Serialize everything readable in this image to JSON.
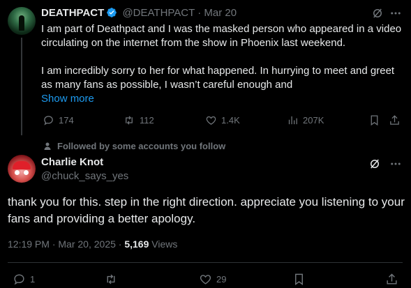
{
  "parent_tweet": {
    "display_name": "DEATHPACT",
    "handle": "@DEATHPACT",
    "separator": "·",
    "date": "Mar 20",
    "text_p1": "I am part of Deathpact and I was the masked person who appeared in a video circulating on the internet from the show in Phoenix last weekend.",
    "text_p2": "I am incredibly sorry to her for what happened. In hurrying to meet and greet as many fans as possible, I wasn’t careful enough and",
    "show_more": "Show more",
    "stats": {
      "replies": "174",
      "reposts": "112",
      "likes": "1.4K",
      "views": "207K"
    }
  },
  "social_context": "Followed by some accounts you follow",
  "reply_tweet": {
    "display_name": "Charlie Knot",
    "handle": "@chuck_says_yes",
    "text": "thank you for this. step in the right direction. appreciate you listening to your fans and providing a better apology.",
    "time": "12:19 PM",
    "date": "Mar 20, 2025",
    "separator": "·",
    "views_count": "5,169",
    "views_label": "Views",
    "stats": {
      "replies": "1",
      "likes": "29"
    }
  },
  "colors": {
    "accent": "#1d9bf0",
    "muted": "#71767b",
    "text": "#e7e9ea",
    "divider": "#2f3336"
  },
  "icons": [
    "grok-icon",
    "more-icon",
    "reply-icon",
    "repost-icon",
    "like-icon",
    "views-icon",
    "bookmark-icon",
    "share-icon",
    "person-icon",
    "verified-badge-icon"
  ]
}
